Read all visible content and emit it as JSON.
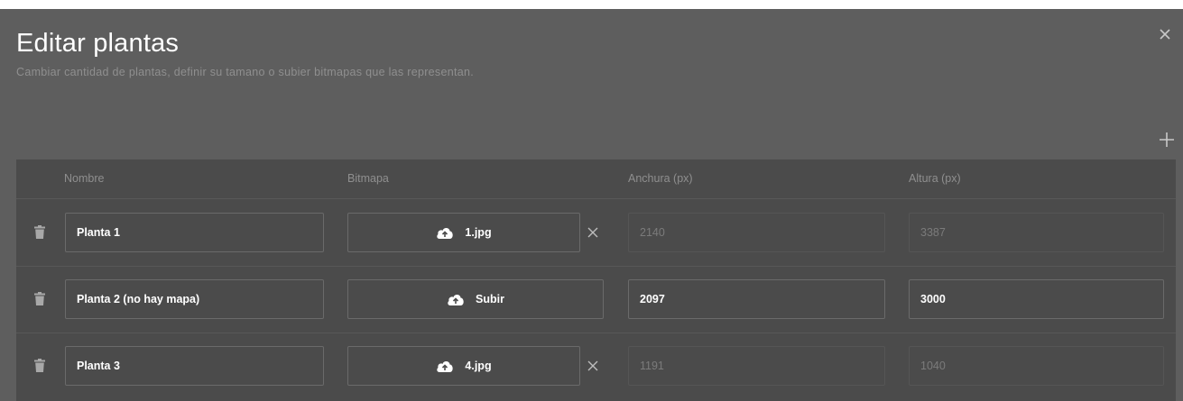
{
  "dialog": {
    "title": "Editar plantas",
    "subtitle": "Cambiar cantidad de plantas, definir su tamano o subier bitmapas que las representan.",
    "close_icon": "close-icon",
    "add_icon": "plus-icon"
  },
  "table": {
    "headers": {
      "name": "Nombre",
      "bitmap": "Bitmapa",
      "width": "Anchura (px)",
      "height": "Altura (px)"
    },
    "rows": [
      {
        "name": "Planta 1",
        "bitmap": "1.jpg",
        "width": "2140",
        "height": "3387",
        "has_file": true
      },
      {
        "name": "Planta 2 (no hay mapa)",
        "bitmap": "Subir",
        "width": "2097",
        "height": "3000",
        "has_file": false
      },
      {
        "name": "Planta 3",
        "bitmap": "4.jpg",
        "width": "1191",
        "height": "1040",
        "has_file": true
      }
    ]
  },
  "colors": {
    "dialog_bg": "#5e5e5e",
    "table_bg": "#4b4b4b",
    "text_primary": "#ffffff",
    "text_muted": "#8f8f8f"
  }
}
